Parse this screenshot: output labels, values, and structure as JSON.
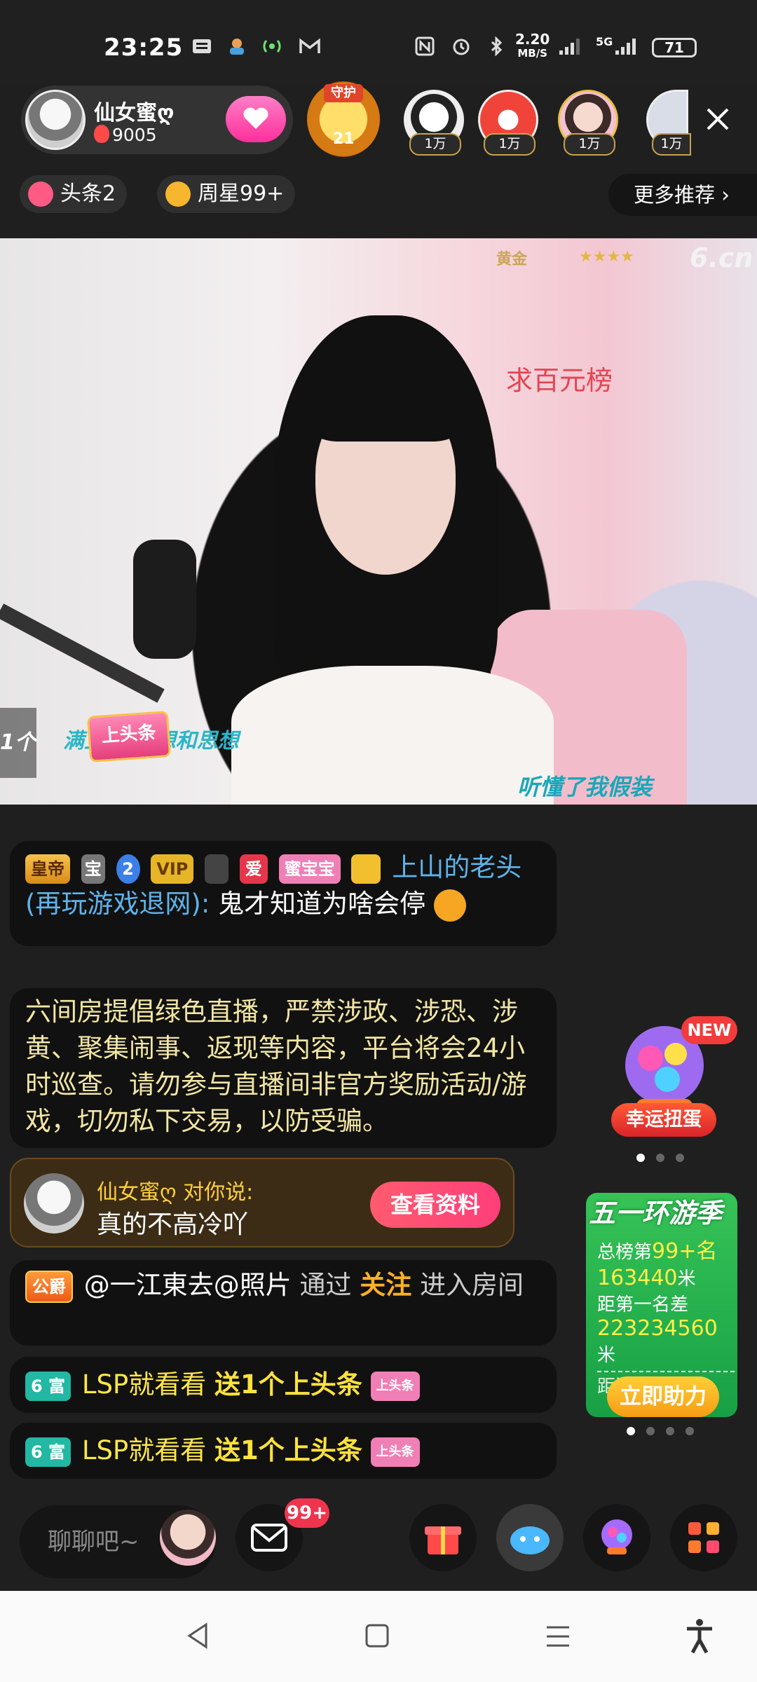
{
  "status_bar": {
    "time": "23:25",
    "speed_value": "2.20",
    "speed_unit": "MB/S",
    "network": "5G",
    "battery": "71",
    "icons": [
      "notification-icon",
      "app-icon",
      "hotspot-icon",
      "gmail-icon",
      "nfc-icon",
      "alarm-icon",
      "bluetooth-icon",
      "signal-icon",
      "signal-5g-icon",
      "battery-icon"
    ]
  },
  "anchor": {
    "name": "仙女蜜ღ",
    "fans": "9005"
  },
  "guard": {
    "label": "守护",
    "count": "21"
  },
  "viewers": [
    {
      "badge": "1万"
    },
    {
      "badge": "1万"
    },
    {
      "badge": "1万"
    },
    {
      "badge": "1万"
    }
  ],
  "tags": {
    "headline": "头条2",
    "weekly_star": "周星99+",
    "more": "更多推荐"
  },
  "video": {
    "rank_badge": "黄金",
    "stars": "★★★★",
    "watermark": "6.cn",
    "overlay_red": "求百元榜",
    "overlay_left": "满上头条",
    "overlay_left_2": "想和思想",
    "overlay_right": "听懂了我假装",
    "headline_gift": "上头条",
    "left_count": "1个"
  },
  "chat": {
    "msg1": {
      "badges": [
        "皇帝",
        "宝",
        "2",
        "VIP",
        "",
        "爱",
        "蜜宝宝",
        ""
      ],
      "user": "上山的老头(再玩游戏退网):",
      "text": "鬼才知道为啥会停"
    },
    "notice": "六间房提倡绿色直播，严禁涉政、涉恐、涉黄、聚集闹事、返现等内容，平台将会24小时巡查。请勿参与直播间非官方奖励活动/游戏，切勿私下交易，以防受骗。",
    "say": {
      "from": "仙女蜜ღ 对你说:",
      "message": "真的不高冷吖",
      "button": "查看资料"
    },
    "enter": {
      "badge": "公爵",
      "user": "@一江東去@照片",
      "via": "通过",
      "action": "关注",
      "suffix": "进入房间"
    },
    "gifts": [
      {
        "level": "6 富",
        "user": "LSP就看看",
        "action": "送1个上头条",
        "gift": "上头条"
      },
      {
        "level": "6 富",
        "user": "LSP就看看",
        "action": "送1个上头条",
        "gift": "上头条"
      }
    ]
  },
  "widgets": {
    "gacha_new": "NEW",
    "gacha_label": "幸运扭蛋",
    "promo_title": "五一环游季",
    "promo_rank_label": "总榜第",
    "promo_rank": "99+名",
    "promo_distance": "163440",
    "promo_unit": "米",
    "promo_gap_label": "距第一名差",
    "promo_gap": "223234560",
    "promo_gap_unit": "米",
    "promo_cut": "距游玩地同差",
    "promo_button": "立即助力"
  },
  "toolbar": {
    "chat_placeholder": "聊聊吧~",
    "mail_badge": "99+"
  }
}
